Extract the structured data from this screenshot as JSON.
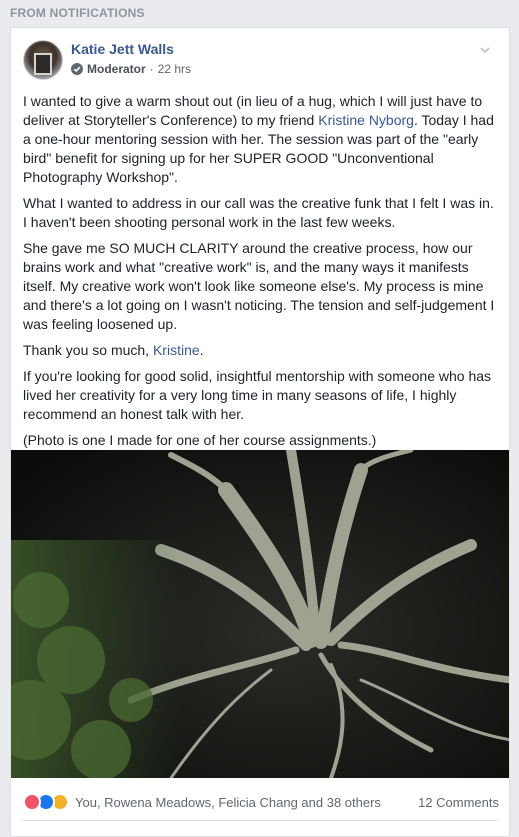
{
  "section_label": "FROM NOTIFICATIONS",
  "post": {
    "author": "Katie Jett Walls",
    "role": "Moderator",
    "separator": "·",
    "time": "22 hrs",
    "paragraphs": [
      {
        "pre": "I wanted to give a warm shout out (in lieu of a hug, which I will just have to deliver at Storyteller's Conference) to my friend ",
        "link": "Kristine Nyborg",
        "post": ". Today I had a one-hour mentoring session with her. The session was part of the \"early bird\" benefit for signing up for her SUPER GOOD \"Unconventional Photography Workshop\"."
      },
      {
        "text": "What I wanted to address in our call was the creative funk that I felt I was in. I haven't been shooting personal work in the last few weeks."
      },
      {
        "text": "She gave me SO MUCH CLARITY around the creative process, how our brains work and what \"creative work\" is, and the many ways it manifests itself. My creative work won't look like someone else's. My process is mine and there's a lot going on I wasn't noticing. The tension and self-judgement I was feeling loosened up."
      },
      {
        "pre": "Thank you so much, ",
        "link": "Kristine",
        "post": "."
      },
      {
        "text": "If you're looking for good solid, insightful mentorship with someone who has lived her creativity for a very long time in many seasons of life, I highly recommend an honest talk with her."
      },
      {
        "text": "(Photo is one I made for one of her course assignments.)"
      }
    ]
  },
  "footer": {
    "reacted_by": "You, Rowena Meadows, Felicia Chang and 38 others",
    "comments": "12 Comments"
  },
  "colors": {
    "link": "#385898",
    "love": "#f25268",
    "like": "#1877f2",
    "wow": "#f7b125"
  }
}
